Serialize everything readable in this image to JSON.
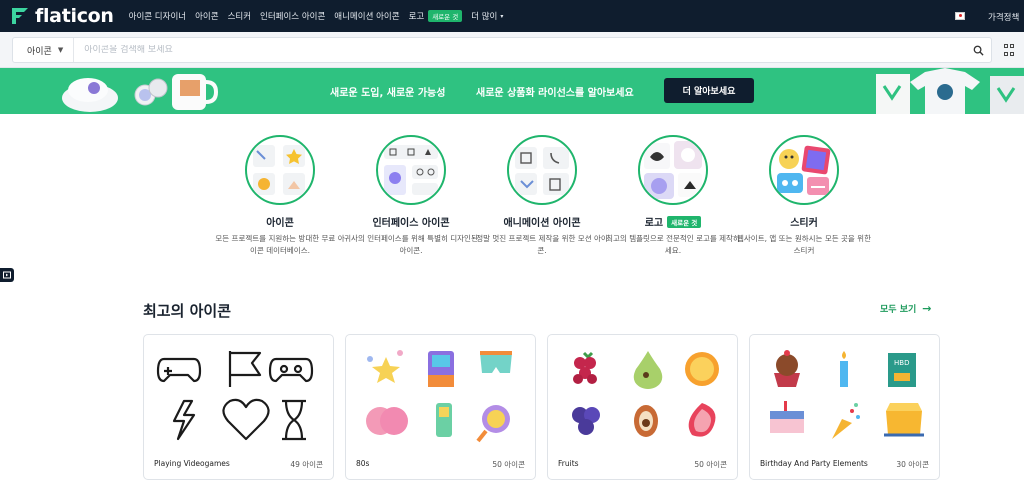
{
  "nav": {
    "logo": "flaticon",
    "items": [
      "아이콘 디자이너",
      "아이콘",
      "스티커",
      "인터페이스 아이콘",
      "애니메이션 아이콘",
      "로고",
      "더 많이"
    ],
    "new_badge": "새로운 것",
    "pricing": "가격정책"
  },
  "search": {
    "type": "아이콘",
    "placeholder": "아이콘을 검색해 보세요"
  },
  "banner": {
    "text1": "새로운 도입, 새로운 가능성",
    "text2": "새로운 상품화 라이선스를 알아보세요",
    "button": "더 알아보세요"
  },
  "categories": [
    {
      "title": "아이콘",
      "desc": "모든 프로젝트를 지원하는 방대한 무료 아이콘 데이터베이스."
    },
    {
      "title": "인터페이스 아이콘",
      "desc": "귀사의 인터페이스를 위해 특별히 디자인된 아이콘."
    },
    {
      "title": "애니메이션 아이콘",
      "desc": "정말 멋진 프로젝트 제작을 위한 모션 아이콘."
    },
    {
      "title": "로고",
      "badge": "새로운 것",
      "desc": "최고의 템플릿으로 전문적인 로고를 제작하세요."
    },
    {
      "title": "스티커",
      "desc": "웹사이트, 앱 또는 원하시는 모든 곳을 위한 스티커"
    }
  ],
  "section": {
    "title": "최고의 아이콘",
    "see_all": "모두 보기"
  },
  "packs": [
    {
      "name": "Playing Videogames",
      "count": "49 아이콘"
    },
    {
      "name": "80s",
      "count": "50 아이콘"
    },
    {
      "name": "Fruits",
      "count": "50 아이콘"
    },
    {
      "name": "Birthday And Party Elements",
      "count": "30 아이콘"
    }
  ],
  "colors": {
    "nav_bg": "#0f1d2e",
    "accent": "#1fb56c",
    "banner_bg": "#2fc281"
  }
}
